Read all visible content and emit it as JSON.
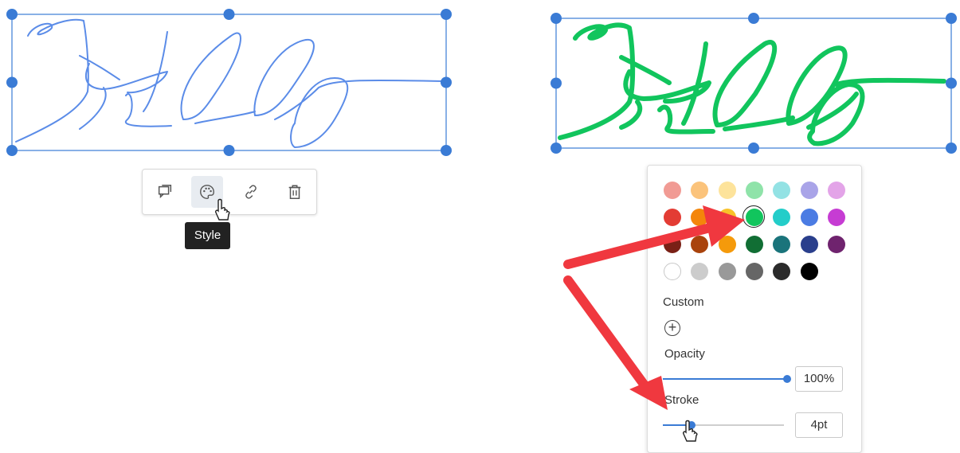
{
  "toolbar": {
    "buttons": [
      {
        "name": "comment",
        "icon": "comment-icon"
      },
      {
        "name": "style",
        "icon": "palette-icon"
      },
      {
        "name": "link",
        "icon": "link-icon"
      },
      {
        "name": "delete",
        "icon": "trash-icon"
      }
    ],
    "tooltip": "Style"
  },
  "drawings": {
    "left_color": "#5b8ce8",
    "right_color": "#11c55d"
  },
  "colors": {
    "selection": "#3a7bd5",
    "annotation_arrow": "#f0383f"
  },
  "style_panel": {
    "swatch_rows": [
      [
        "#f19b94",
        "#fbc37b",
        "#fde39b",
        "#8fe3a9",
        "#93e2e4",
        "#a9a4e8",
        "#e3a4e8"
      ],
      [
        "#e33c34",
        "#f4860b",
        "#f8c22a",
        "#11c55d",
        "#23cdc9",
        "#4b7ce3",
        "#c63cd3"
      ],
      [
        "#7a2016",
        "#a9430c",
        "#f59a0b",
        "#116e34",
        "#1a747b",
        "#2a3f8c",
        "#6f236e"
      ],
      [
        "#ffffff",
        "#cccccc",
        "#999999",
        "#666666",
        "#2b2b2b",
        "#000000"
      ]
    ],
    "selected_color": "#11c55d",
    "custom_label": "Custom",
    "opacity_label": "Opacity",
    "opacity_value": "100%",
    "opacity_level": 1.0,
    "stroke_label": "Stroke",
    "stroke_value": "4pt",
    "stroke_level": 0.24
  }
}
